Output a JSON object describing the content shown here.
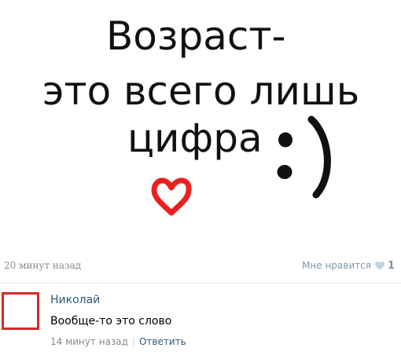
{
  "post": {
    "image": {
      "caption_lines": [
        "Возраст-",
        "это всего лишь",
        "цифра"
      ],
      "emoticon": ":)"
    },
    "time": "20 минут назад",
    "like_label": "Мне нравится",
    "like_count": "1"
  },
  "comment": {
    "author": "Николай",
    "text": "Вообще-то это слово",
    "time": "14 минут назад",
    "separator": "|",
    "reply_label": "Ответить"
  },
  "colors": {
    "link": "#2b587a",
    "muted": "#8a8a8a",
    "like": "#7f95ad",
    "avatar_border": "#d42a2a",
    "heart": "#e8211f"
  },
  "icons": {
    "heart": "heart-icon",
    "smiley": "smiley-icon",
    "like_heart": "like-heart-icon"
  }
}
